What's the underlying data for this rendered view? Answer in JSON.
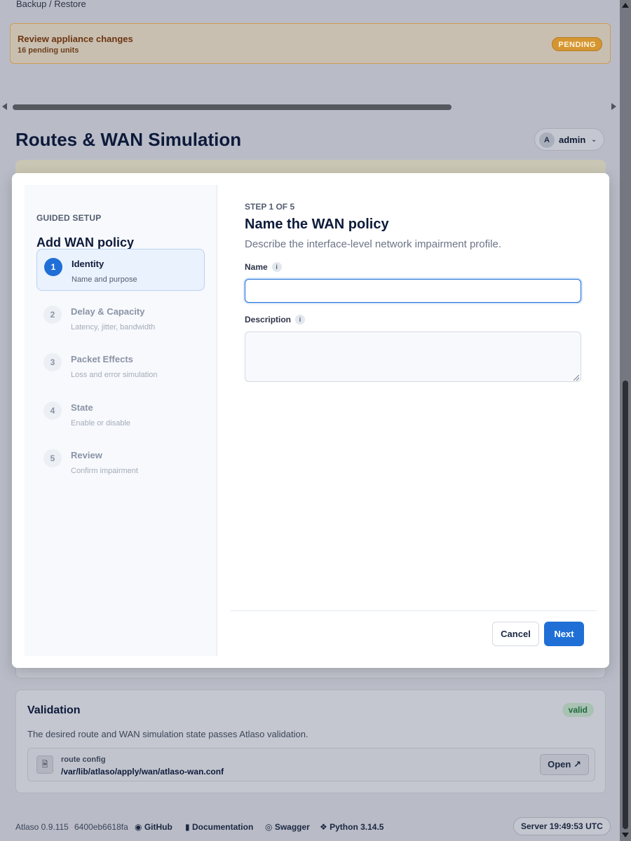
{
  "breadcrumb": "Backup / Restore",
  "pending_banner": {
    "title": "Review appliance changes",
    "subtitle": "16 pending units",
    "badge": "PENDING"
  },
  "page": {
    "title": "Routes & WAN Simulation"
  },
  "user_menu": {
    "avatar_initial": "A",
    "username": "admin",
    "chevron_icon": "chevron-down-icon"
  },
  "modal": {
    "kicker": "GUIDED SETUP",
    "title": "Add WAN policy",
    "steps": [
      {
        "number": "1",
        "name": "Identity",
        "subtitle": "Name and purpose",
        "active": true
      },
      {
        "number": "2",
        "name": "Delay & Capacity",
        "subtitle": "Latency, jitter, bandwidth",
        "active": false
      },
      {
        "number": "3",
        "name": "Packet Effects",
        "subtitle": "Loss and error simulation",
        "active": false
      },
      {
        "number": "4",
        "name": "State",
        "subtitle": "Enable or disable",
        "active": false
      },
      {
        "number": "5",
        "name": "Review",
        "subtitle": "Confirm impairment",
        "active": false
      }
    ],
    "step_indicator": "STEP 1 OF 5",
    "step_title": "Name the WAN policy",
    "step_description": "Describe the interface-level network impairment profile.",
    "fields": {
      "name_label": "Name",
      "name_value": "",
      "description_label": "Description",
      "description_value": "",
      "info_glyph": "i"
    },
    "buttons": {
      "cancel": "Cancel",
      "next": "Next"
    }
  },
  "validation": {
    "title": "Validation",
    "badge": "valid",
    "description": "The desired route and WAN simulation state passes Atlaso validation.",
    "config_label": "route config",
    "config_path": "/var/lib/atlaso/apply/wan/atlaso-wan.conf",
    "open_button": "Open ↗"
  },
  "footer": {
    "version": "Atlaso 0.9.115",
    "commit": "6400eb6618fa",
    "github": "GitHub",
    "documentation": "Documentation",
    "swagger": "Swagger",
    "python": "Python 3.14.5",
    "server_time": "Server 19:49:53 UTC"
  },
  "colors": {
    "accent": "#1f6fd6",
    "pending": "#d59632",
    "valid": "#1f6b3e"
  }
}
